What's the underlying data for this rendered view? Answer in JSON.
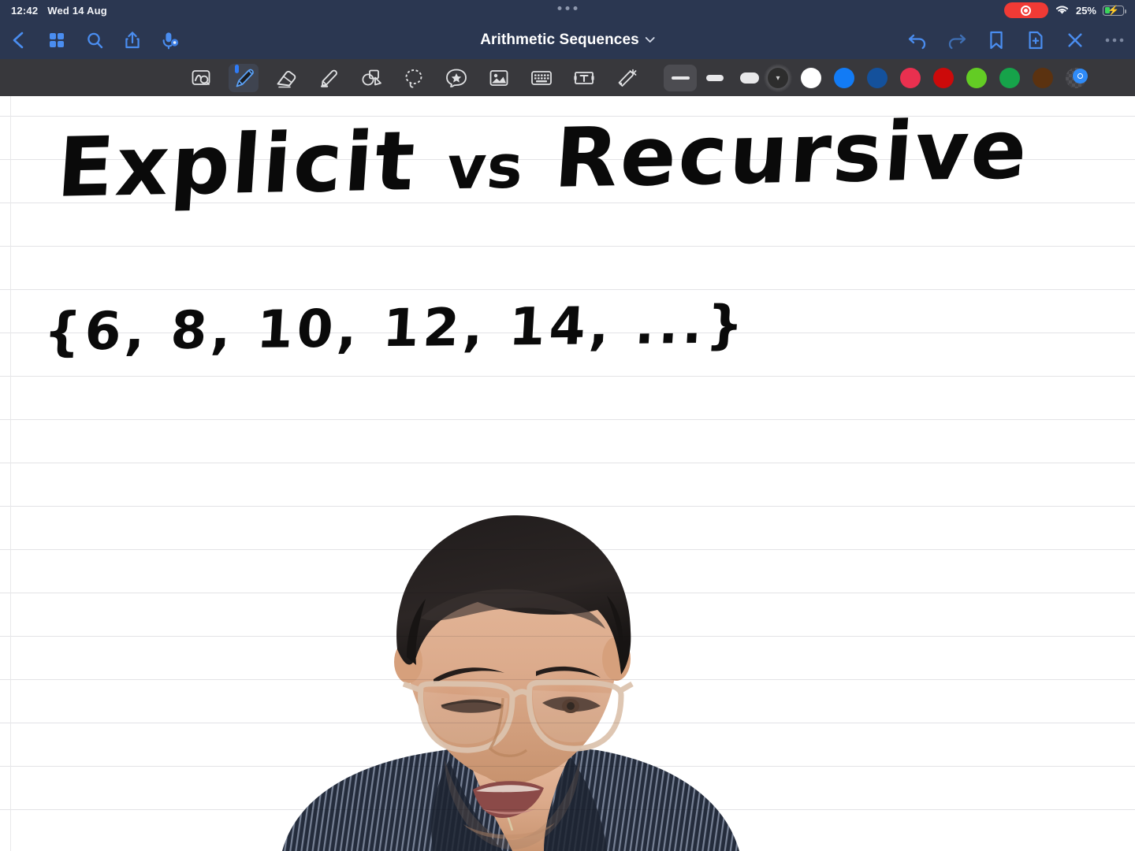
{
  "status_bar": {
    "time": "12:42",
    "date": "Wed 14 Aug",
    "battery_percent": "25%",
    "battery_level": 25,
    "recording": true,
    "wifi": "wifi-icon",
    "icons": [
      "record-indicator",
      "wifi-icon",
      "battery-icon"
    ]
  },
  "nav_bar": {
    "title": "Arithmetic Sequences",
    "title_chevron": "chevron-down-icon",
    "left_buttons": [
      {
        "name": "back-button",
        "icon": "chevron-left-icon"
      },
      {
        "name": "page-thumbnails-button",
        "icon": "grid-icon"
      },
      {
        "name": "search-button",
        "icon": "search-icon"
      },
      {
        "name": "share-button",
        "icon": "share-icon"
      },
      {
        "name": "audio-record-button",
        "icon": "microphone-icon"
      }
    ],
    "right_buttons": [
      {
        "name": "undo-button",
        "icon": "undo-arrow-icon"
      },
      {
        "name": "redo-button",
        "icon": "redo-arrow-icon"
      },
      {
        "name": "bookmark-button",
        "icon": "bookmark-icon"
      },
      {
        "name": "add-page-button",
        "icon": "document-plus-icon"
      },
      {
        "name": "close-button",
        "icon": "close-x-icon"
      },
      {
        "name": "more-options-button",
        "icon": "ellipsis-icon"
      }
    ]
  },
  "tool_bar": {
    "tools": [
      {
        "name": "zoom-tool",
        "icon": "magnify-box-icon",
        "selected": false
      },
      {
        "name": "pen-tool",
        "icon": "pen-icon",
        "selected": true
      },
      {
        "name": "eraser-tool",
        "icon": "eraser-icon",
        "selected": false
      },
      {
        "name": "highlighter-tool",
        "icon": "highlighter-icon",
        "selected": false
      },
      {
        "name": "shape-tool",
        "icon": "shapes-icon",
        "selected": false
      },
      {
        "name": "lasso-tool",
        "icon": "lasso-icon",
        "selected": false
      },
      {
        "name": "sticker-tool",
        "icon": "star-sticker-icon",
        "selected": false
      },
      {
        "name": "image-tool",
        "icon": "image-icon",
        "selected": false
      },
      {
        "name": "keyboard-tool",
        "icon": "keyboard-icon",
        "selected": false
      },
      {
        "name": "text-box-tool",
        "icon": "text-box-icon",
        "selected": false
      },
      {
        "name": "magic-wand-tool",
        "icon": "magic-wand-icon",
        "selected": false
      }
    ],
    "thickness": [
      {
        "name": "thickness-thin",
        "size": "thin",
        "selected": true
      },
      {
        "name": "thickness-medium",
        "size": "medium",
        "selected": false
      },
      {
        "name": "thickness-thick",
        "size": "thick",
        "selected": false
      }
    ],
    "colors": [
      {
        "name": "color-black",
        "hex": "#0b0b0b",
        "selected": true
      },
      {
        "name": "color-white",
        "hex": "#ffffff",
        "selected": false
      },
      {
        "name": "color-bright-blue",
        "hex": "#127bf5",
        "selected": false
      },
      {
        "name": "color-dark-blue",
        "hex": "#14519c",
        "selected": false
      },
      {
        "name": "color-pink",
        "hex": "#e9304f",
        "selected": false
      },
      {
        "name": "color-red",
        "hex": "#cc0a0a",
        "selected": false
      },
      {
        "name": "color-light-green",
        "hex": "#63cc24",
        "selected": false
      },
      {
        "name": "color-green",
        "hex": "#16a34a",
        "selected": false
      },
      {
        "name": "color-brown",
        "hex": "#5b3210",
        "selected": false
      }
    ],
    "custom_color_button": {
      "name": "custom-color-picker",
      "hex": "#2f8bf8"
    }
  },
  "canvas": {
    "paper_color": "#ffffff",
    "rule_color": "#e3e3e6",
    "rule_spacing": 55,
    "handwriting": {
      "heading": "Explicit vs Recursive",
      "heading_parts": {
        "left": "Explicit",
        "middle": "vs",
        "right": "Recursive"
      },
      "sequence": "{6, 8, 10, 12, 14, ...}",
      "sequence_values": [
        6,
        8,
        10,
        12,
        14
      ],
      "ink_color": "#0a0a0a"
    },
    "webcam_overlay": {
      "name": "presenter-video-overlay",
      "description": "presenter with glasses and striped shirt"
    }
  }
}
